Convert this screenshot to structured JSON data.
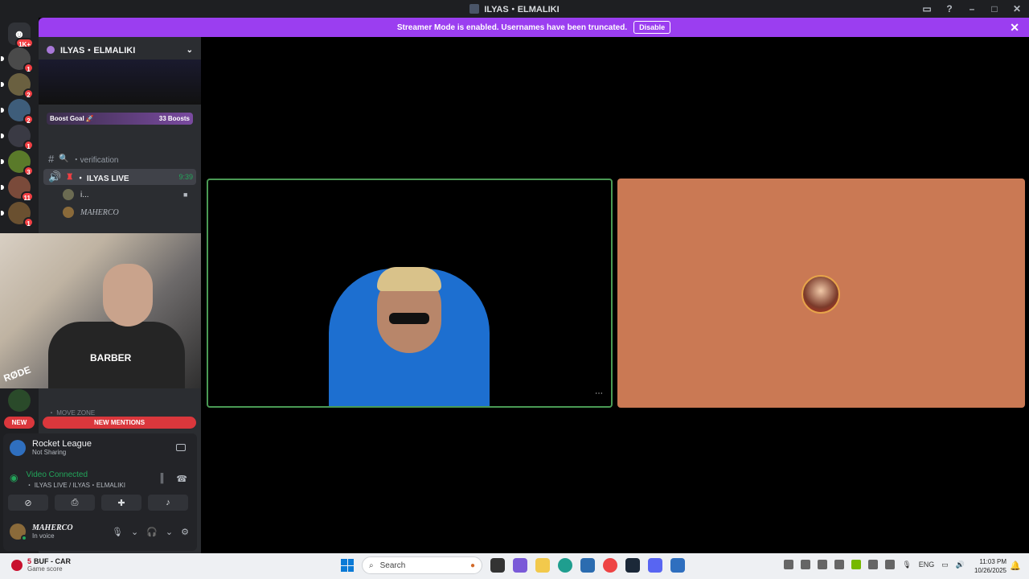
{
  "window": {
    "title": "ILYAS・ELMALIKI",
    "controls": [
      "minimize-icon",
      "maximize-icon",
      "close-icon"
    ]
  },
  "banner": {
    "message": "Streamer Mode is enabled. Usernames have been truncated.",
    "disable_label": "Disable",
    "color": "#9b3ef0"
  },
  "servers": [
    {
      "badge": "1K+"
    },
    {
      "badge": "1"
    },
    {
      "badge": "2"
    },
    {
      "badge": "2"
    },
    {
      "badge": "1"
    },
    {
      "badge": "3"
    },
    {
      "badge": "11"
    },
    {
      "badge": "1"
    }
  ],
  "sidebar": {
    "server_name": "ILYAS・ELMALIKI",
    "boost_goal": "Boost Goal 🚀",
    "boost_count": "33 Boosts",
    "channels": [
      {
        "name": "・verification",
        "type": "text"
      },
      {
        "name": "・ ILYAS LIVE",
        "type": "voice",
        "timer": "9:39",
        "active": true
      }
    ],
    "voice_members": [
      "i...",
      "MAHERCO"
    ],
    "move_zone": "・ MOVE ZONE",
    "new_label": "NEW",
    "mentions_label": "NEW MENTIONS"
  },
  "panel": {
    "game": {
      "title": "Rocket League",
      "status": "Not Sharing"
    },
    "voice": {
      "status": "Video Connected",
      "location": "・ ILYAS LIVE / ILYAS・ELMALIKI"
    },
    "user": {
      "name": "MAHERCO",
      "status": "In voice"
    }
  },
  "webcam": {
    "shirt_text": "BARBER",
    "mic_brand": "RØDE"
  },
  "video": {
    "tile2_color": "#ca7954",
    "more_label": "⋯"
  },
  "taskbar": {
    "weather_title": "BUF - CAR",
    "weather_subtitle": "Game score",
    "weather_badge": "5",
    "search_placeholder": "Search",
    "lang": "ENG",
    "time": "11:03 PM",
    "date": "10/26/2025"
  }
}
